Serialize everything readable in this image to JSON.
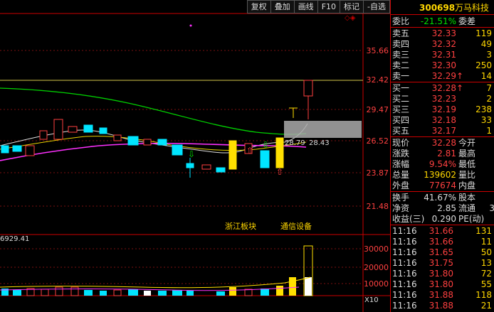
{
  "toolbar": {
    "buttons": [
      "复权",
      "叠加",
      "画线",
      "F10",
      "标记",
      "-自选"
    ],
    "window": [
      "◇",
      "◈"
    ]
  },
  "chart": {
    "price_axis": [
      "35.66",
      "32.42",
      "29.47",
      "26.52",
      "23.87",
      "21.48"
    ],
    "volume_axis": [
      "30000",
      "20000",
      "10000"
    ],
    "ma_labels": {
      "a": "28.79",
      "b": "28.43"
    },
    "annotations": [
      "浙江板块",
      "通信设备"
    ],
    "volume_corner": "6929.41",
    "pane_index": "X10"
  },
  "stock": {
    "code": "300698",
    "name": "万马科技"
  },
  "wei": {
    "label": "委比",
    "value": "-21.51%",
    "label2": "委差"
  },
  "asks": [
    {
      "label": "卖五",
      "price": "32.33",
      "vol": "119"
    },
    {
      "label": "卖四",
      "price": "32.32",
      "vol": "49"
    },
    {
      "label": "卖三",
      "price": "32.31",
      "vol": "3"
    },
    {
      "label": "卖二",
      "price": "32.30",
      "vol": "250"
    },
    {
      "label": "卖一",
      "price": "32.29",
      "vol": "14",
      "arrow": "↑"
    }
  ],
  "bids": [
    {
      "label": "买一",
      "price": "32.28",
      "vol": "7",
      "arrow": "↑"
    },
    {
      "label": "买二",
      "price": "32.23",
      "vol": "2"
    },
    {
      "label": "买三",
      "price": "32.19",
      "vol": "238"
    },
    {
      "label": "买四",
      "price": "32.18",
      "vol": "33"
    },
    {
      "label": "买五",
      "price": "32.17",
      "vol": "1"
    }
  ],
  "quote": [
    {
      "l1": "现价",
      "v1": "32.28",
      "l2": "今开"
    },
    {
      "l1": "涨跌",
      "v1": "2.81",
      "l2": "最高"
    },
    {
      "l1": "涨幅",
      "v1": "9.54%",
      "l2": "最低"
    },
    {
      "l1": "总量",
      "v1": "139602",
      "l2": "量比"
    },
    {
      "l1": "外盘",
      "v1": "77674",
      "l2": "内盘"
    }
  ],
  "stats": [
    {
      "l1": "换手",
      "v1": "41.67%",
      "l2": "股本"
    },
    {
      "l1": "净资",
      "v1": "2.85",
      "l2": "流通",
      "v2": "3"
    },
    {
      "l1": "收益(三)",
      "v1": "0.290",
      "l2": "PE(动)"
    }
  ],
  "ticks": [
    {
      "t": "11:16",
      "p": "31.66",
      "v": "131"
    },
    {
      "t": "11:16",
      "p": "31.66",
      "v": "11"
    },
    {
      "t": "11:16",
      "p": "31.65",
      "v": "50"
    },
    {
      "t": "11:16",
      "p": "31.75",
      "v": "13"
    },
    {
      "t": "11:16",
      "p": "31.80",
      "v": "72"
    },
    {
      "t": "11:16",
      "p": "31.80",
      "v": "55"
    },
    {
      "t": "11:16",
      "p": "31.88",
      "v": "118"
    },
    {
      "t": "11:16",
      "p": "31.88",
      "v": "21"
    }
  ]
}
